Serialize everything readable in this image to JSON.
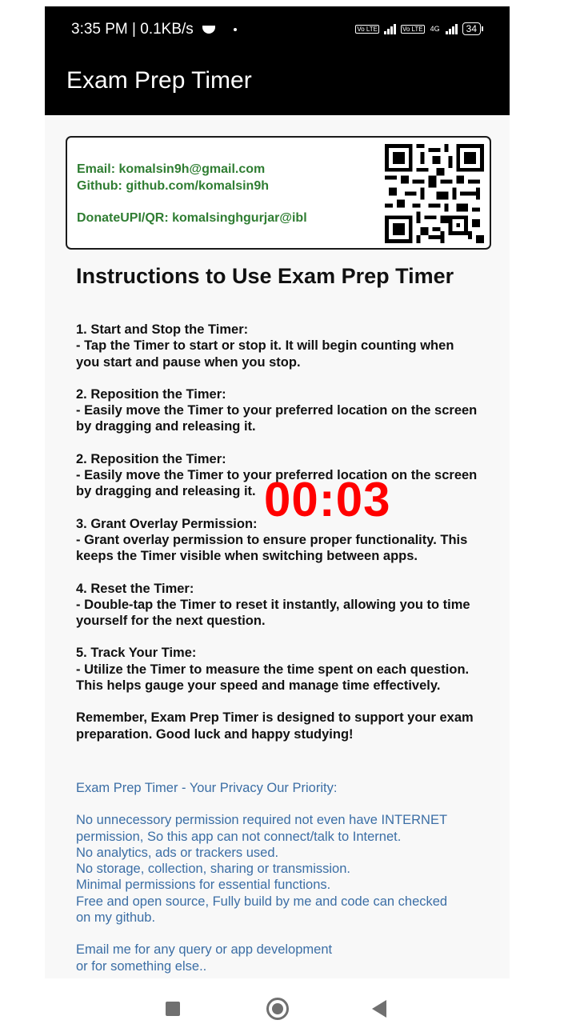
{
  "status_bar": {
    "time_speed": "3:35 PM | 0.1KB/s",
    "volte1": "Vo LTE",
    "volte2": "Vo LTE",
    "network": "4G",
    "battery": "34"
  },
  "app": {
    "title": "Exam Prep Timer"
  },
  "contact": {
    "email": "Email: komalsin9h@gmail.com",
    "github": "Github: github.com/komalsin9h",
    "donate": "DonateUPI/QR: komalsinghgurjar@ibl"
  },
  "instructions": {
    "title": "Instructions to Use Exam Prep Timer",
    "sections": [
      [
        "1. Start and Stop the Timer:",
        " - Tap the Timer to start or stop it. It will begin counting when",
        "you start and pause when you stop."
      ],
      [
        "2. Reposition the Timer:",
        " - Easily move the Timer to your preferred location on the screen",
        "by dragging and releasing it."
      ],
      [
        "2. Reposition the Timer:",
        " - Easily move the Timer to your preferred location on the screen",
        "by dragging and releasing it."
      ],
      [
        "3. Grant Overlay Permission:",
        " - Grant overlay permission to ensure proper functionality. This",
        "keeps the Timer visible when switching between apps."
      ],
      [
        "4. Reset the Timer:",
        " - Double-tap the Timer to reset it instantly, allowing you to time",
        "yourself for the next question."
      ],
      [
        "5. Track Your Time:",
        " - Utilize the Timer to measure the time spent on each question.",
        "This helps gauge your speed and manage time effectively."
      ],
      [
        " Remember, Exam Prep Timer is designed to support your exam",
        "preparation. Good luck and happy studying!"
      ]
    ]
  },
  "privacy": {
    "heading": "Exam Prep Timer - Your Privacy Our Priority:",
    "lines": [
      "No unnecessory permission required not even have INTERNET",
      "permission, So this app can not connect/talk to Internet.",
      "No analytics, ads or trackers used.",
      "No storage, collection, sharing or transmission.",
      "Minimal permissions for essential functions.",
      "Free and open source, Fully build by me and code can checked",
      "on my github."
    ],
    "footer": [
      "Email me for any query or app development",
      "or for something else.."
    ]
  },
  "timer": {
    "display": "00:03",
    "color": "#ff0000"
  },
  "colors": {
    "contact": "#2f7d32",
    "privacy": "#3b6ea5"
  },
  "icons": {
    "qr": "qr-code-icon",
    "nav_recent": "square-icon",
    "nav_home": "circle-icon",
    "nav_back": "triangle-back-icon"
  }
}
